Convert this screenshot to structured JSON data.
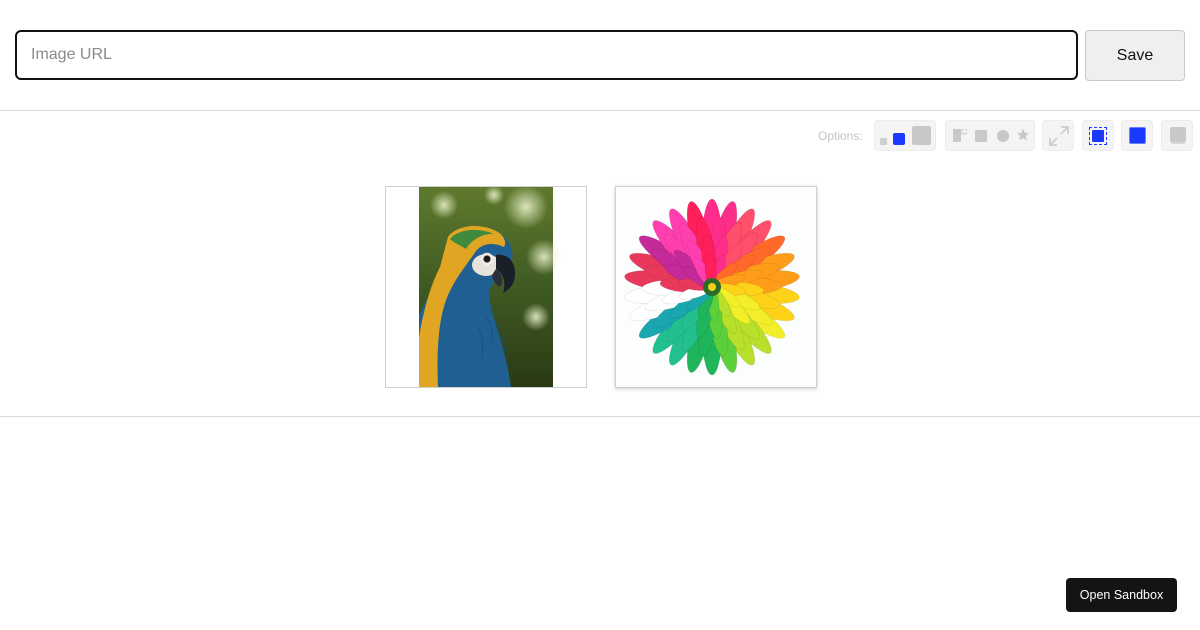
{
  "editor": {
    "url_placeholder": "Image URL",
    "url_value": "",
    "save_label": "Save"
  },
  "options": {
    "label": "Options:",
    "buttons": [
      {
        "name": "size-options",
        "icon": "size-icon"
      },
      {
        "name": "shape-options",
        "icon": "shape-icon"
      },
      {
        "name": "fullscreen-option",
        "icon": "expand-icon"
      },
      {
        "name": "border-dashed-option",
        "icon": "dashed-border-icon"
      },
      {
        "name": "border-solid-option",
        "icon": "solid-border-icon"
      },
      {
        "name": "shadow-option",
        "icon": "shadow-icon"
      }
    ],
    "accent_color": "#1a3bff"
  },
  "gallery": {
    "images": [
      {
        "name": "parrot-image",
        "subject": "blue-and-yellow macaw"
      },
      {
        "name": "flower-image",
        "subject": "rainbow chrysanthemum"
      }
    ]
  },
  "footer": {
    "sandbox_label": "Open Sandbox"
  }
}
